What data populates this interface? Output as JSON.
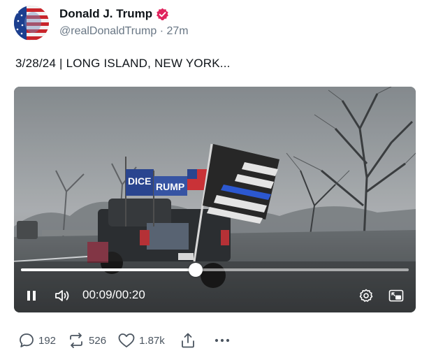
{
  "author": {
    "display_name": "Donald J. Trump",
    "handle": "@realDonaldTrump",
    "separator": "·",
    "time_ago": "27m",
    "verified": true
  },
  "post": {
    "text": "3/28/24 | LONG ISLAND, NEW YORK..."
  },
  "video": {
    "current_time": "00:09",
    "duration": "00:20",
    "progress": 0.45,
    "flag_text": "DICE",
    "flag_text_2": "RUMP"
  },
  "engagement": {
    "replies": "192",
    "reposts": "526",
    "likes": "1.87k"
  },
  "icons": {
    "reply": "comment-bubble-icon",
    "repost": "repost-arrows-icon",
    "like": "heart-icon",
    "share": "share-icon",
    "more": "more-dots-icon"
  },
  "colors": {
    "verified_badge": "#e0245e",
    "muted_text": "#687684"
  }
}
